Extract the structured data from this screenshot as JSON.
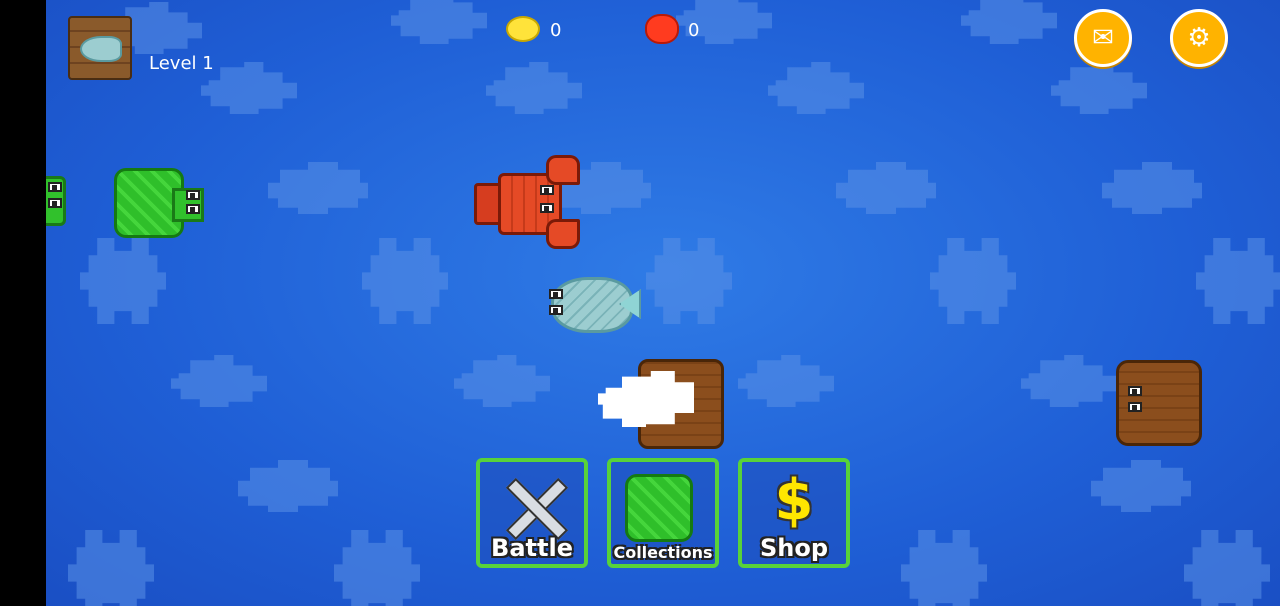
{
  "hud": {
    "level_label": "Level 1",
    "coins": "0",
    "gems": "0",
    "level_icon": "fish-icon",
    "coin_icon": "coin-icon",
    "gem_icon": "gem-icon",
    "mail_icon": "mail-icon",
    "settings_icon": "gear-icon"
  },
  "menu": {
    "battle_label": "Battle",
    "collections_label": "Collections",
    "shop_label": "Shop",
    "battle_icon": "crossed-swords-icon",
    "collections_icon": "turtle-icon",
    "shop_icon": "dollar-icon"
  },
  "colors": {
    "water": "#2f7be6",
    "button_border": "#58d23a",
    "round_button": "#ffb300",
    "coin": "#ffe33a",
    "gem": "#ff3b1f"
  }
}
